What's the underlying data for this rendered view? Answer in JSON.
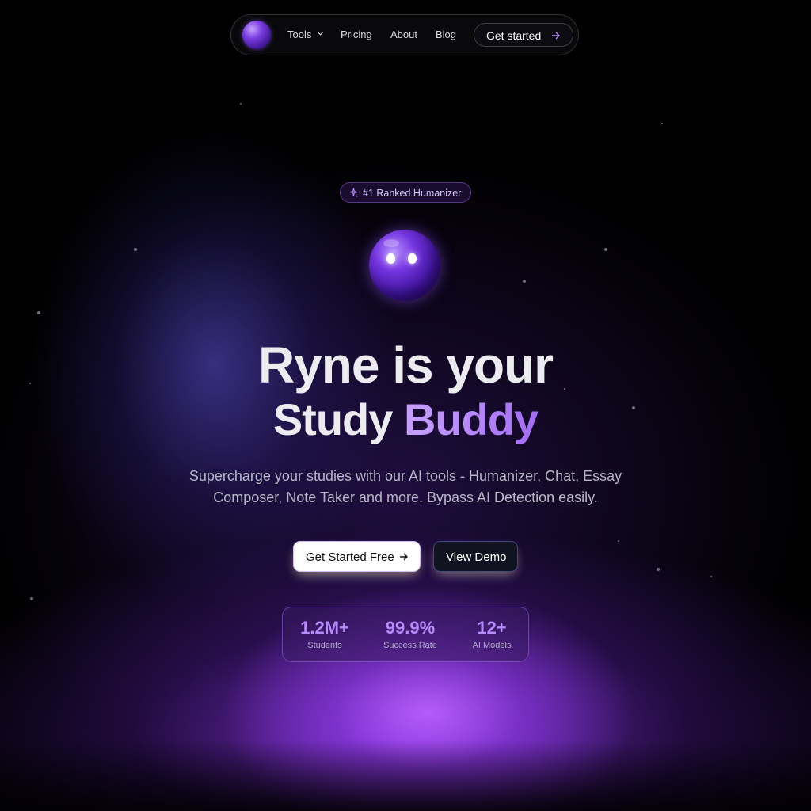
{
  "nav": {
    "logo_icon": "ryne-orb-logo",
    "tools_label": "Tools",
    "tools_chevron_icon": "chevron-down-icon",
    "pricing_label": "Pricing",
    "about_label": "About",
    "blog_label": "Blog",
    "cta_label": "Get started",
    "cta_icon": "arrow-right-icon"
  },
  "hero": {
    "badge_icon": "sparkles-icon",
    "badge_label": "#1 Ranked Humanizer",
    "mascot_icon": "ryne-mascot",
    "headline_line1": "Ryne is your",
    "headline_line2_plain": "Study",
    "headline_line2_accent": "Buddy",
    "subtitle": "Supercharge your studies with our AI tools - Humanizer, Chat, Essay Composer, Note Taker and more. Bypass AI Detection easily.",
    "primary_button_label": "Get Started Free",
    "primary_button_icon": "arrow-right-icon",
    "secondary_button_label": "View Demo"
  },
  "stats": [
    {
      "value": "1.2M+",
      "label": "Students"
    },
    {
      "value": "99.9%",
      "label": "Success Rate"
    },
    {
      "value": "12+",
      "label": "AI Models"
    }
  ],
  "colors": {
    "accent": "#b98bff",
    "background": "#000000",
    "primary_button_bg": "#ffffff",
    "secondary_button_bg": "#111320"
  }
}
